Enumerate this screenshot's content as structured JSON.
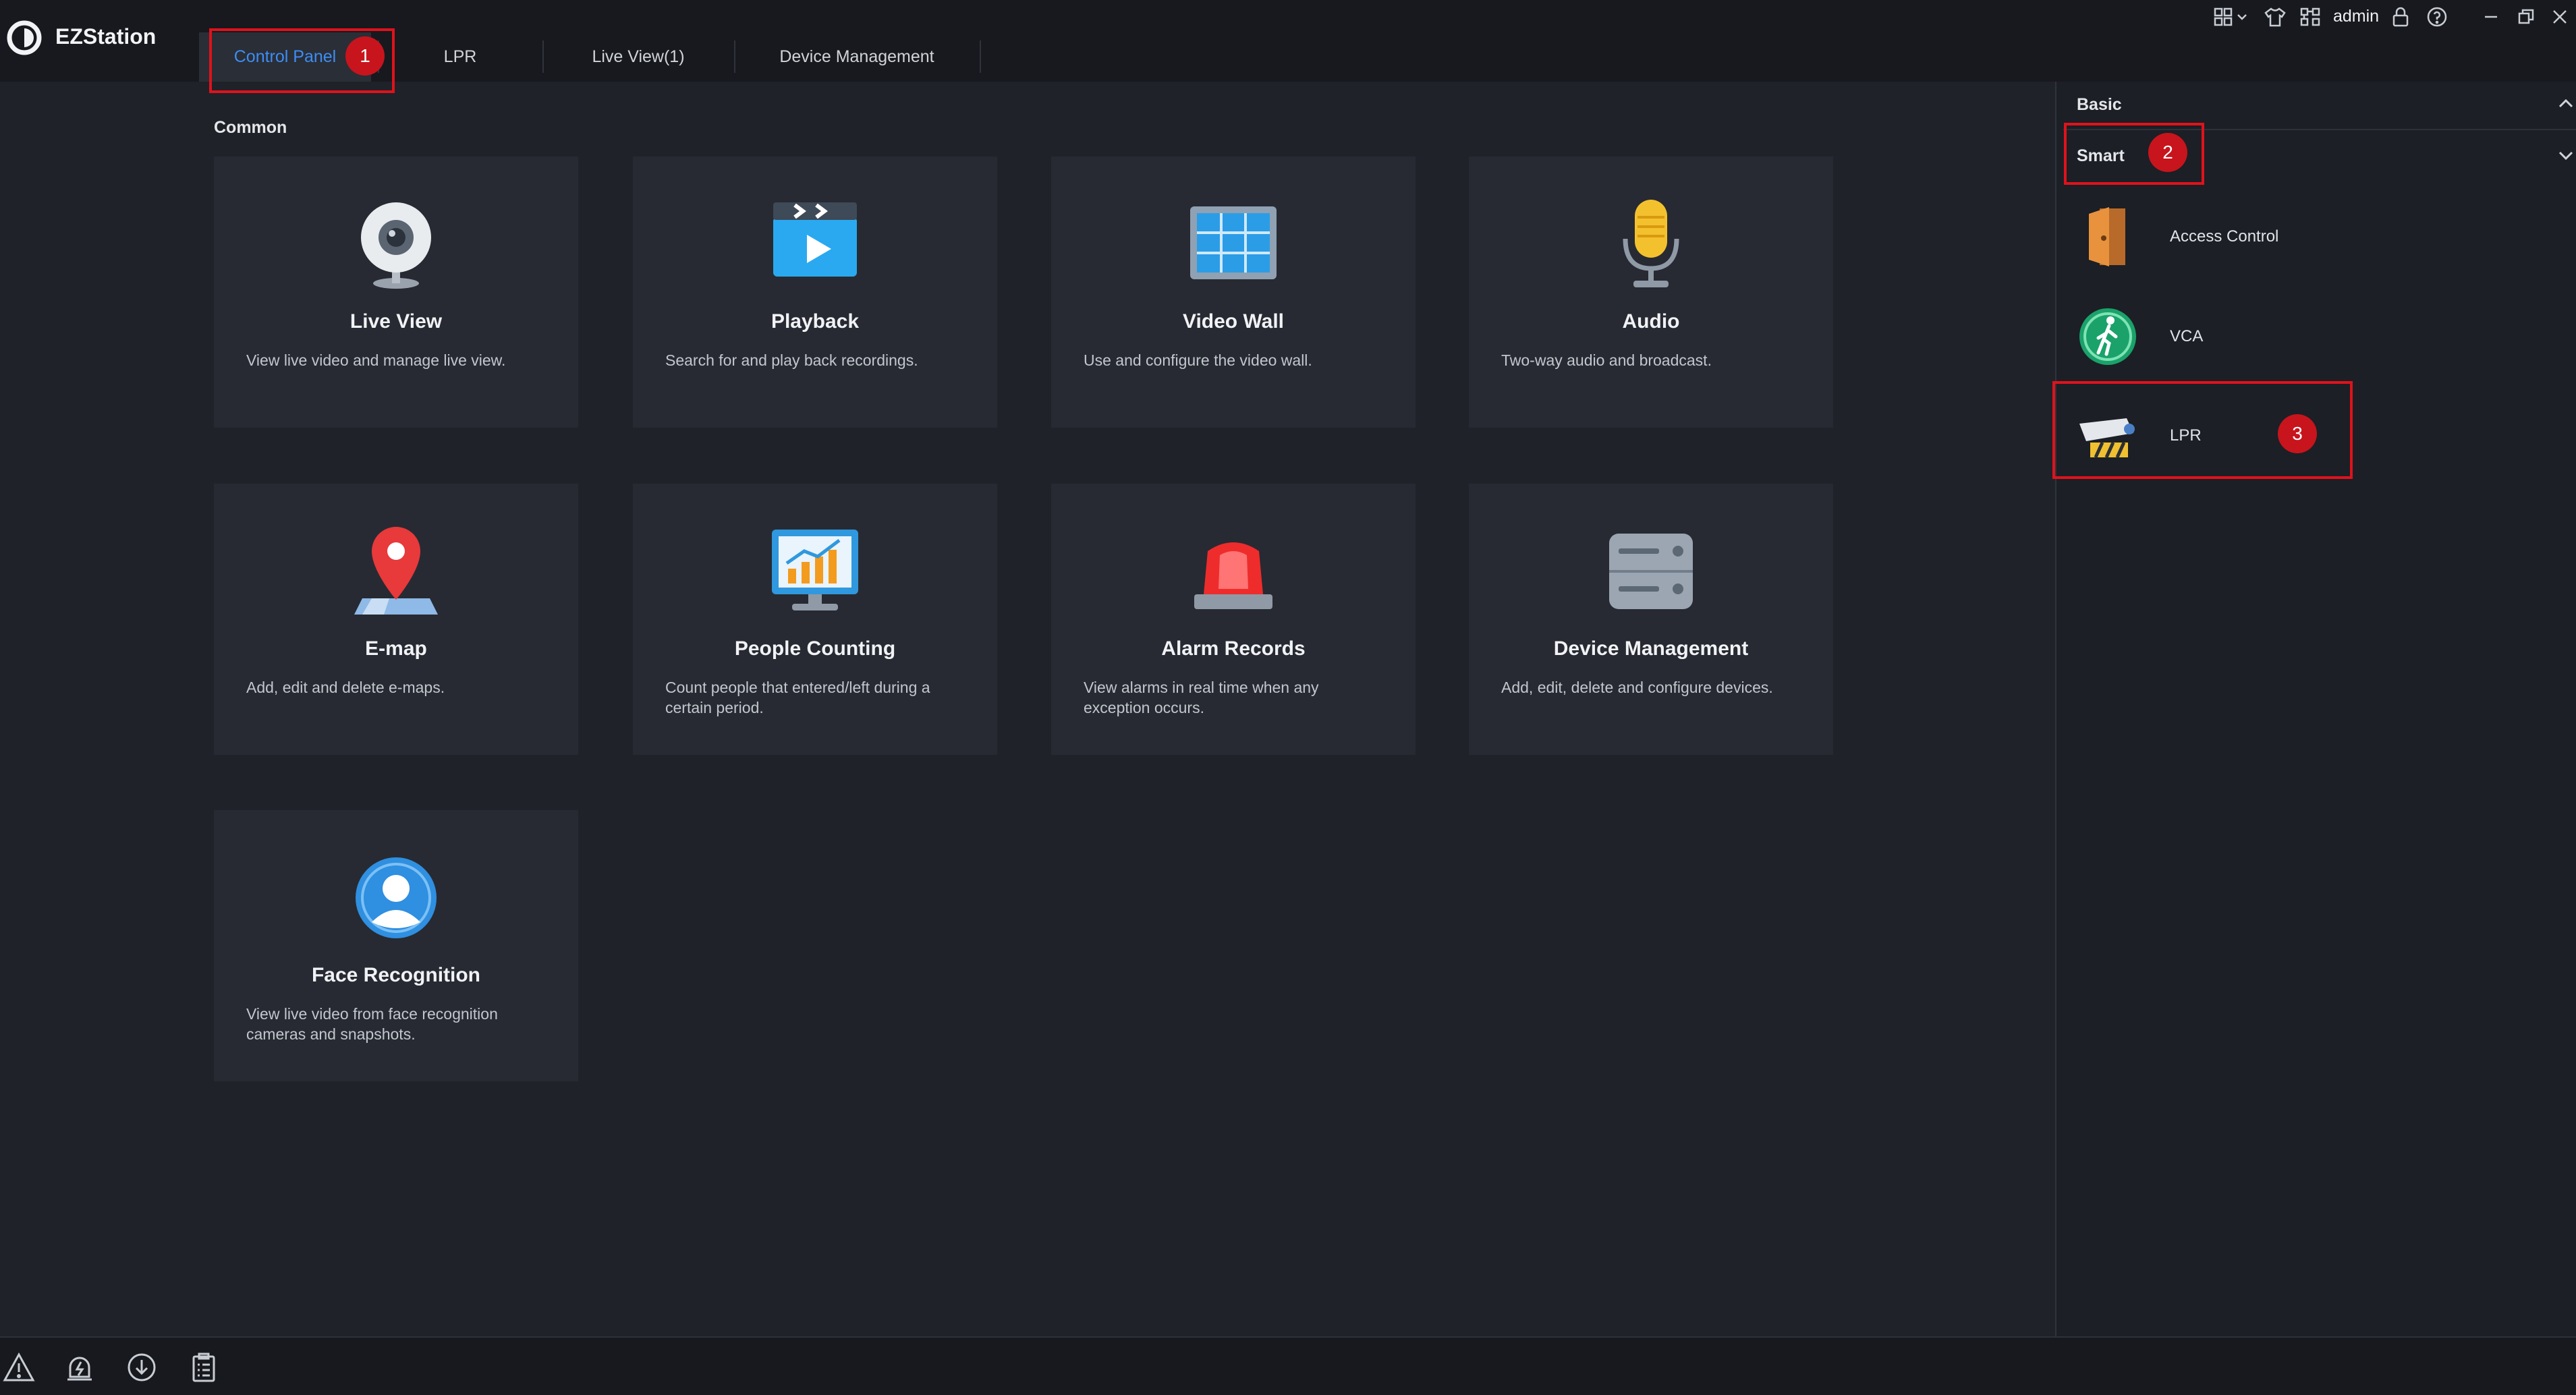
{
  "app": {
    "name": "EZStation"
  },
  "tabs": [
    {
      "label": "Control Panel"
    },
    {
      "label": "LPR"
    },
    {
      "label": "Live View(1)"
    },
    {
      "label": "Device Management"
    }
  ],
  "toolbar": {
    "user": "admin"
  },
  "main": {
    "section_title": "Common",
    "cards": [
      {
        "title": "Live View",
        "desc": "View live video and manage live view.",
        "icon": "webcam-icon"
      },
      {
        "title": "Playback",
        "desc": "Search for and play back recordings.",
        "icon": "playback-icon"
      },
      {
        "title": "Video Wall",
        "desc": "Use and configure the video wall.",
        "icon": "video-wall-icon"
      },
      {
        "title": "Audio",
        "desc": "Two-way audio and broadcast.",
        "icon": "microphone-icon"
      },
      {
        "title": "E-map",
        "desc": "Add, edit and delete e-maps.",
        "icon": "map-pin-icon"
      },
      {
        "title": "People Counting",
        "desc": "Count people that entered/left during a certain period.",
        "icon": "chart-monitor-icon"
      },
      {
        "title": "Alarm Records",
        "desc": "View alarms in real time when any exception occurs.",
        "icon": "alarm-light-icon"
      },
      {
        "title": "Device Management",
        "desc": "Add, edit, delete and configure devices.",
        "icon": "server-icon"
      },
      {
        "title": "Face Recognition",
        "desc": "View live video from face recognition cameras and snapshots.",
        "icon": "face-icon"
      }
    ]
  },
  "right_panel": {
    "basic_label": "Basic",
    "smart_label": "Smart",
    "items": [
      {
        "label": "Access Control",
        "icon": "door-icon"
      },
      {
        "label": "VCA",
        "icon": "walking-person-icon"
      },
      {
        "label": "LPR",
        "icon": "lpr-camera-icon"
      }
    ]
  },
  "annotations": [
    "1",
    "2",
    "3"
  ],
  "colors": {
    "accent": "#3d8df5",
    "highlight": "#e0121b",
    "badge": "#c8141c",
    "background": "#1f2229"
  }
}
